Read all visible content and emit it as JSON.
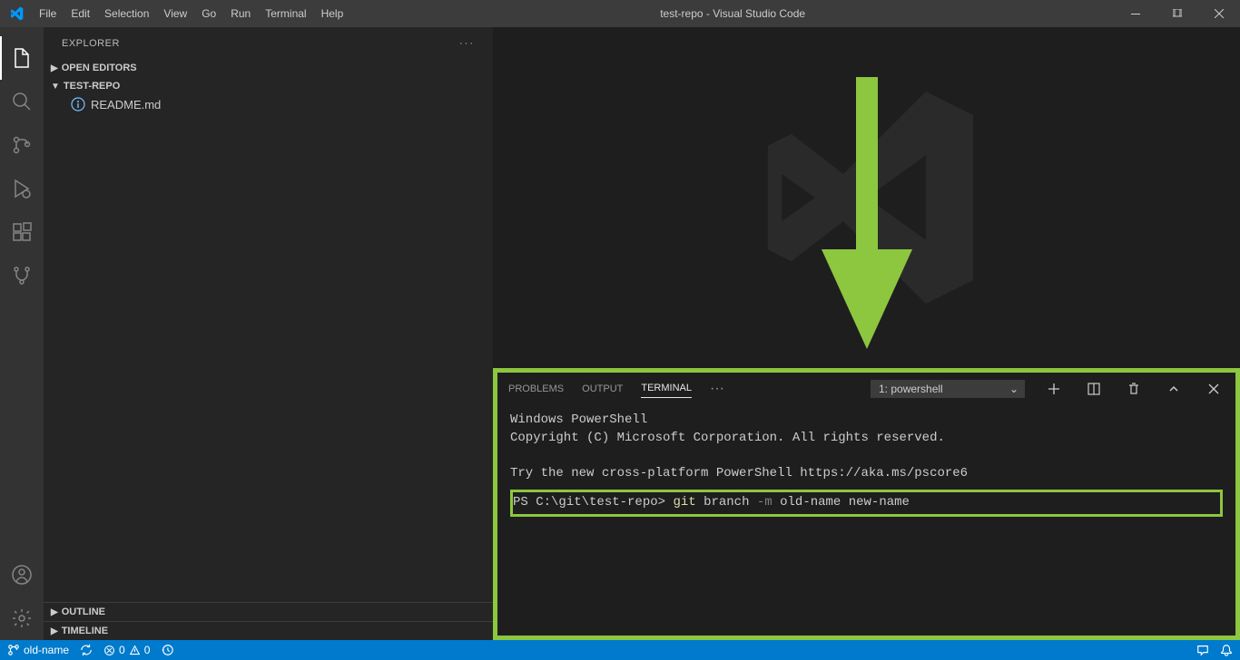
{
  "window": {
    "title": "test-repo - Visual Studio Code"
  },
  "menu": [
    "File",
    "Edit",
    "Selection",
    "View",
    "Go",
    "Run",
    "Terminal",
    "Help"
  ],
  "explorer": {
    "title": "EXPLORER",
    "open_editors": "OPEN EDITORS",
    "folder": "TEST-REPO",
    "files": [
      "README.md"
    ],
    "outline": "OUTLINE",
    "timeline": "TIMELINE"
  },
  "panel": {
    "tabs": {
      "problems": "PROBLEMS",
      "output": "OUTPUT",
      "terminal": "TERMINAL"
    },
    "terminal_select": "1: powershell",
    "terminal_content": {
      "line1": "Windows PowerShell",
      "line2": "Copyright (C) Microsoft Corporation. All rights reserved.",
      "line3": "Try the new cross-platform PowerShell https://aka.ms/pscore6",
      "prompt": "PS C:\\git\\test-repo>",
      "cmd_git": "git",
      "cmd_branch": "branch",
      "cmd_flag": "-m",
      "cmd_args": "old-name new-name"
    }
  },
  "statusbar": {
    "branch": "old-name",
    "errors": "0",
    "warnings": "0"
  }
}
